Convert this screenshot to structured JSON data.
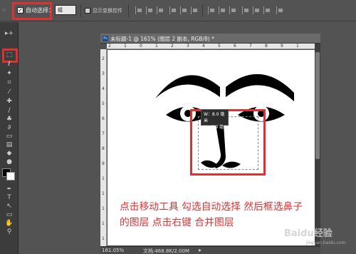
{
  "options_bar": {
    "grip": "⁘",
    "checkmark": "✓",
    "auto_select_label": "自动选择：",
    "auto_select_value": "组",
    "show_transform_label": "显示变换控件"
  },
  "toolbox": {
    "tools": [
      {
        "name": "move-tool-icon",
        "glyph": "▸+"
      },
      {
        "name": "marquee-tool-icon",
        "glyph": "⬚"
      },
      {
        "name": "lasso-tool-icon",
        "glyph": "ℓ"
      },
      {
        "name": "wand-tool-icon",
        "glyph": "✦"
      },
      {
        "name": "crop-tool-icon",
        "glyph": "⌗"
      },
      {
        "name": "eyedropper-tool-icon",
        "glyph": "⁄"
      },
      {
        "name": "healing-tool-icon",
        "glyph": "✚"
      },
      {
        "name": "brush-tool-icon",
        "glyph": "∕"
      },
      {
        "name": "stamp-tool-icon",
        "glyph": "♣"
      },
      {
        "name": "history-brush-tool-icon",
        "glyph": "∂"
      },
      {
        "name": "eraser-tool-icon",
        "glyph": "▭"
      },
      {
        "name": "gradient-tool-icon",
        "glyph": "▤"
      },
      {
        "name": "blur-tool-icon",
        "glyph": "◆"
      },
      {
        "name": "dodge-tool-icon",
        "glyph": "●"
      },
      {
        "name": "pen-tool-icon",
        "glyph": "✒"
      },
      {
        "name": "type-tool-icon",
        "glyph": "T"
      },
      {
        "name": "path-select-tool-icon",
        "glyph": "↖"
      },
      {
        "name": "shape-tool-icon",
        "glyph": "▭"
      },
      {
        "name": "hand-tool-icon",
        "glyph": "✋"
      },
      {
        "name": "zoom-tool-icon",
        "glyph": "⚲"
      }
    ]
  },
  "document": {
    "ps_badge": "Ps",
    "title": "未标题-1 @ 161% (图层 2 副本, RGB/8) *",
    "ruler_top_numbers": [
      "2",
      "1",
      "0",
      "1",
      "2",
      "3",
      "4",
      "5",
      "6",
      "7",
      "8",
      "9",
      "1"
    ],
    "ruler_left_numbers": [
      "2",
      "3",
      "4",
      "5",
      "6",
      "7",
      "8",
      "9",
      "1",
      "1",
      "1",
      "1",
      "1"
    ],
    "tooltip_w": "W：8.0 毫米",
    "tooltip_h": "H：6.9 毫米",
    "status_zoom": "161.05%",
    "status_doc": "文档:468.8K/2.00M",
    "status_arrow": "▸"
  },
  "instruction": {
    "line1": "点击移动工具 勾选自动选择 然后框选鼻子",
    "line2": "的图层 点击右键 合并图层"
  },
  "watermark": {
    "text": "Baidu经验",
    "sub": "jingyan.baidu.com"
  },
  "colors": {
    "highlight": "#e03131",
    "foreground": "#000000",
    "background": "#ffffff"
  }
}
